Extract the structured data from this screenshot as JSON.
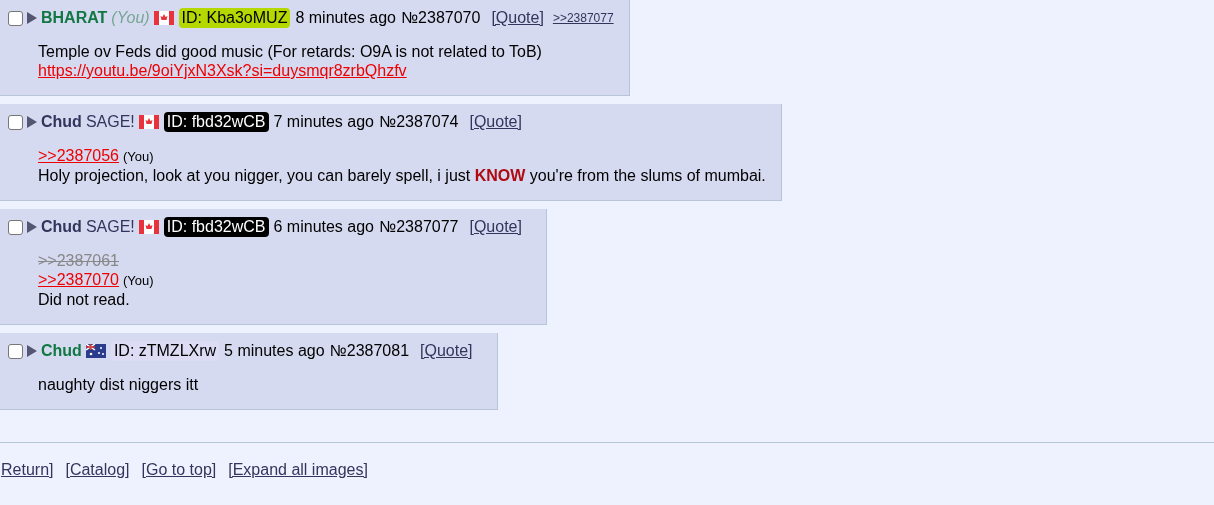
{
  "posts": [
    {
      "name": {
        "text": "BHARAT",
        "color": "#117743"
      },
      "you": "(You)",
      "flag": {
        "kind": "ca"
      },
      "id": {
        "text": "ID: Kba3oMUZ",
        "color": "#b4d800"
      },
      "time": "8 minutes ago",
      "number": "№2387070",
      "quote": "[Quote]",
      "backlinks": [
        ">>2387077"
      ],
      "checked": false,
      "body": [
        {
          "kind": "text",
          "text": "Temple ov Feds did good music (For retards: O9A is not related to ToB)"
        },
        {
          "kind": "link",
          "text": "https://youtu.be/9oiYjxN3Xsk?si=duysmqr8zrbQhzfv"
        }
      ]
    },
    {
      "name": {
        "text": "Chud",
        "color": "#34345c"
      },
      "sage": "SAGE!",
      "flag": {
        "kind": "ca"
      },
      "id": {
        "text": "ID: fbd32wCB",
        "color": "#000000"
      },
      "time": "7 minutes ago",
      "number": "№2387074",
      "quote": "[Quote]",
      "checked": false,
      "body": [
        {
          "kind": "quote",
          "text": ">>2387056",
          "you": "(You)",
          "dead": false
        },
        {
          "kind": "text",
          "text": "Holy projection, look at you nigger, you can barely spell, i just **KNOW** you're from the slums of mumbai."
        }
      ]
    },
    {
      "name": {
        "text": "Chud",
        "color": "#34345c"
      },
      "sage": "SAGE!",
      "flag": {
        "kind": "ca"
      },
      "id": {
        "text": "ID: fbd32wCB",
        "color": "#000000"
      },
      "time": "6 minutes ago",
      "number": "№2387077",
      "quote": "[Quote]",
      "checked": false,
      "body": [
        {
          "kind": "quote",
          "text": ">>2387061",
          "dead": true
        },
        {
          "kind": "quote",
          "text": ">>2387070",
          "you": "(You)",
          "dead": false
        },
        {
          "kind": "text",
          "text": "Did not read."
        }
      ]
    },
    {
      "name": {
        "text": "Chud",
        "color": "#117743"
      },
      "flag": {
        "kind": "au"
      },
      "id": {
        "text": "ID: zTMZLXrw",
        "color": "#dcdcf5"
      },
      "time": "5 minutes ago",
      "number": "№2387081",
      "quote": "[Quote]",
      "checked": false,
      "body": [
        {
          "kind": "text",
          "text": "naughty dist niggers itt"
        }
      ]
    }
  ],
  "footer_links": [
    "Return]",
    "[Catalog]",
    "[Go to top]",
    "[Expand all images]"
  ]
}
